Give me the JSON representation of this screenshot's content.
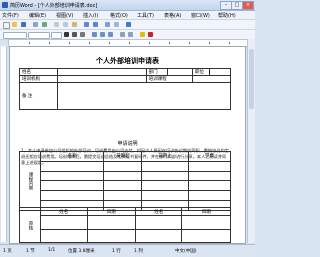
{
  "window": {
    "title": "简历Word - [个人外部培训申请表.doc]",
    "minimize": "–",
    "maximize": "□",
    "close": "×"
  },
  "menu": [
    "文件(F)",
    "编辑(E)",
    "视图(V)",
    "插入(I)",
    "格式(O)",
    "工具(T)",
    "表格(A)",
    "窗口(W)",
    "帮助(H)"
  ],
  "document": {
    "title": "个人外部培训申请表",
    "row1": {
      "name_label": "姓名",
      "dept_label": "部门",
      "position_label": "职位"
    },
    "row2": {
      "org_label": "培训机构",
      "course_label": "培训课程"
    },
    "remark_label": "备 注",
    "section_title": "申请说明",
    "notice": "1、本人申请参加公司组织的外部培训，培训费用由公司支付。如因个人原因在培训协议期内离职，需按协议约定退还相应培训费用。培训结束后，需提交培训总结及相关证书复印件，并在部门内部进行分享。本人已阅读并同意上述规定。",
    "plan": {
      "side_label": "课程内容",
      "headers": [
        "名称",
        "日期起",
        "日期止",
        "学费"
      ]
    },
    "approval": {
      "side_label": "审核",
      "headers": [
        "姓名",
        "日期",
        "姓名",
        "日期"
      ]
    }
  },
  "status": {
    "page": "1 页",
    "section": "1 节",
    "pages": "1/1",
    "position": "位置 3.8厘米",
    "line": "1 行",
    "column": "1 列",
    "lang": "中文(中国)"
  }
}
